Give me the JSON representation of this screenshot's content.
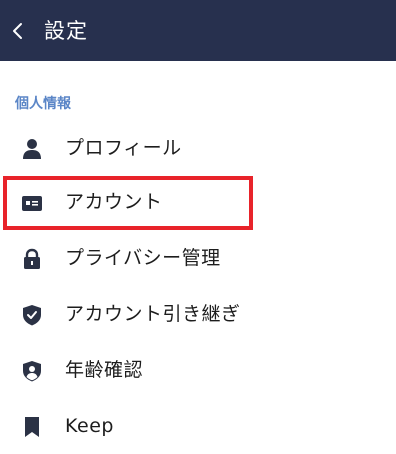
{
  "header": {
    "title": "設定",
    "back_icon": "chevron-left-icon",
    "background": "#27304e"
  },
  "section": {
    "title": "個人情報",
    "color": "#5b86c7"
  },
  "items": [
    {
      "label": "プロフィール",
      "icon": "person-icon"
    },
    {
      "label": "アカウント",
      "icon": "id-card-icon"
    },
    {
      "label": "プライバシー管理",
      "icon": "lock-icon"
    },
    {
      "label": "アカウント引き継ぎ",
      "icon": "shield-check-icon"
    },
    {
      "label": "年齢確認",
      "icon": "shield-person-icon"
    },
    {
      "label": "Keep",
      "icon": "bookmark-icon"
    }
  ],
  "highlight": {
    "target": "アカウント",
    "color": "#e8232a"
  }
}
